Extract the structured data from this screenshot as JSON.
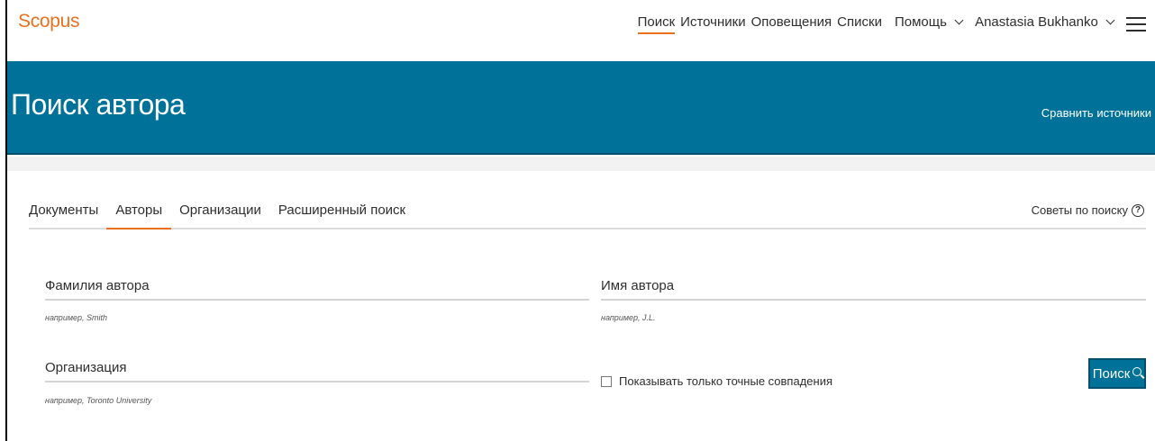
{
  "app": {
    "logo": "Scopus"
  },
  "nav": {
    "search": "Поиск",
    "sources": "Источники",
    "alerts": "Оповещения",
    "lists": "Списки",
    "help": "Помощь",
    "user": "Anastasia Bukhanko"
  },
  "banner": {
    "title": "Поиск автора",
    "compare_link": "Сравнить источники"
  },
  "tabs": [
    {
      "label": "Документы"
    },
    {
      "label": "Авторы"
    },
    {
      "label": "Организации"
    },
    {
      "label": "Расширенный поиск"
    }
  ],
  "tips": {
    "label": "Советы по поиску"
  },
  "form": {
    "last_name_label": "Фамилия автора",
    "last_name_hint": "например, Smith",
    "first_name_label": "Имя автора",
    "first_name_hint": "например, J.L.",
    "affiliation_label": "Организация",
    "affiliation_hint": "например, Toronto University",
    "exact_match_label": "Показывать только точные совпадения",
    "exact_match_checked": false,
    "search_button": "Поиск"
  },
  "colors": {
    "brand_orange": "#e9711c",
    "banner_blue": "#00729a"
  },
  "icons": {
    "help": "question-circle-icon",
    "search": "magnifier-icon",
    "menu": "hamburger-menu-icon",
    "dropdown": "chevron-down-icon"
  }
}
